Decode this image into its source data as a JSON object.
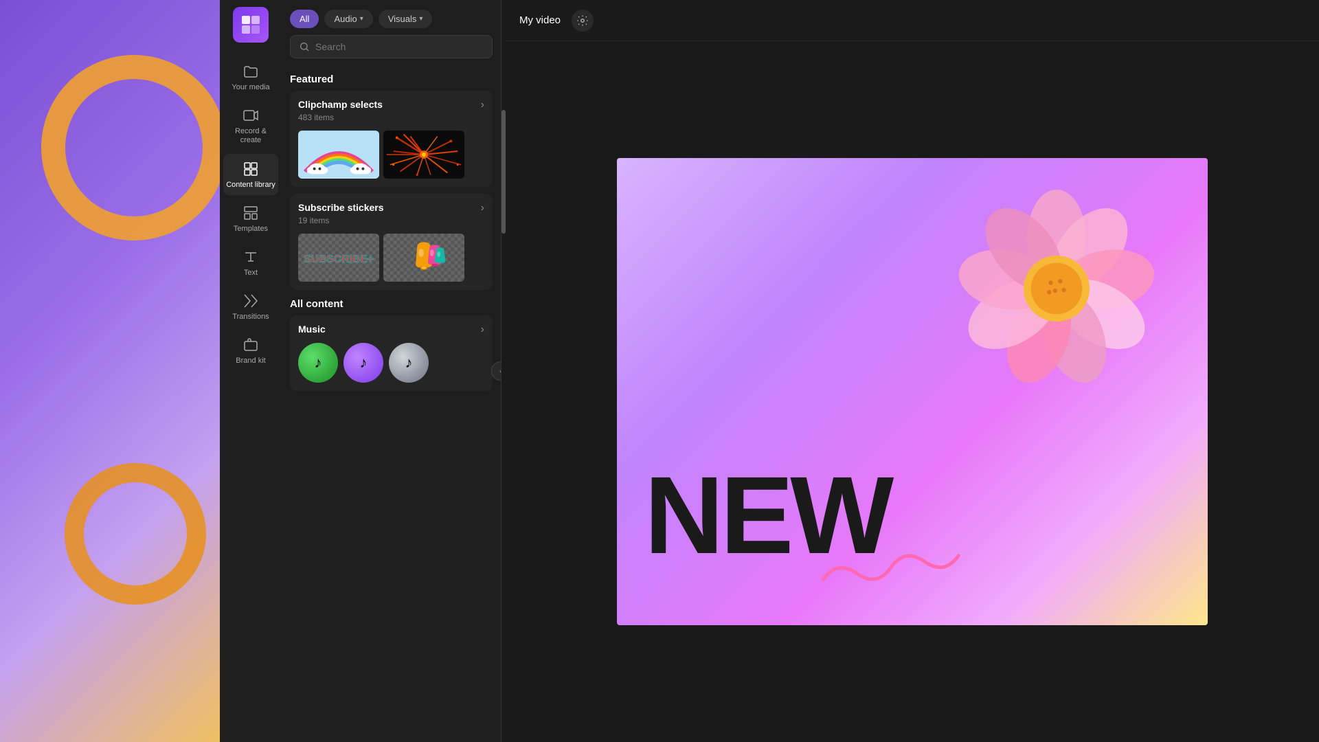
{
  "app": {
    "title": "Clipchamp"
  },
  "sidebar": {
    "logo_alt": "Clipchamp logo",
    "items": [
      {
        "id": "your-media",
        "label": "Your media",
        "icon": "folder-icon"
      },
      {
        "id": "record-create",
        "label": "Record &\ncreate",
        "icon": "record-icon"
      },
      {
        "id": "content-library",
        "label": "Content library",
        "icon": "content-library-icon",
        "active": true
      },
      {
        "id": "templates",
        "label": "Templates",
        "icon": "templates-icon"
      },
      {
        "id": "text",
        "label": "Text",
        "icon": "text-icon"
      },
      {
        "id": "transitions",
        "label": "Transitions",
        "icon": "transitions-icon"
      },
      {
        "id": "brand-kit",
        "label": "Brand kit",
        "icon": "brand-kit-icon"
      }
    ]
  },
  "filters": {
    "all_label": "All",
    "audio_label": "Audio",
    "visuals_label": "Visuals"
  },
  "search": {
    "placeholder": "Search"
  },
  "featured": {
    "section_title": "Featured",
    "collections": [
      {
        "id": "clipchamp-selects",
        "title": "Clipchamp selects",
        "count": "483 items"
      },
      {
        "id": "subscribe-stickers",
        "title": "Subscribe stickers",
        "count": "19 items"
      }
    ]
  },
  "all_content": {
    "section_title": "All content",
    "categories": [
      {
        "id": "music",
        "label": "Music"
      }
    ]
  },
  "header": {
    "video_title": "My video",
    "settings_icon": "settings-icon"
  }
}
